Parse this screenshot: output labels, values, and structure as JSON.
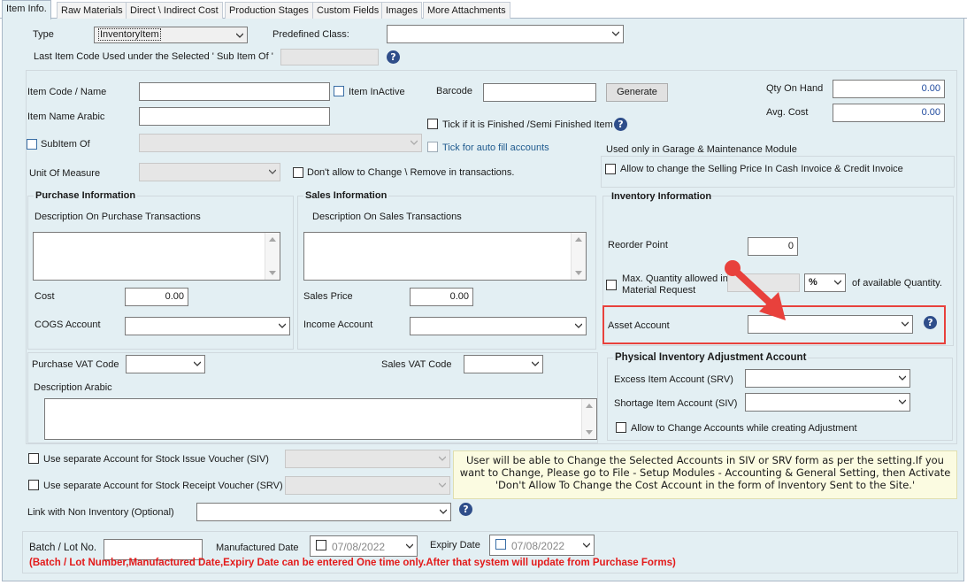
{
  "tabs": [
    {
      "label": "Item Info.",
      "active": true
    },
    {
      "label": "Raw Materials",
      "active": false
    },
    {
      "label": "Direct \\ Indirect Cost",
      "active": false
    },
    {
      "label": "Production Stages",
      "active": false
    },
    {
      "label": "Custom Fields",
      "active": false
    },
    {
      "label": "Images",
      "active": false
    },
    {
      "label": "More Attachments",
      "active": false
    }
  ],
  "top": {
    "type_label": "Type",
    "type_value": "InventoryItem",
    "predefined_class_label": "Predefined Class:",
    "predefined_class_value": "",
    "last_code_label": "Last Item Code Used under the Selected ' Sub Item Of '",
    "last_code_value": ""
  },
  "item": {
    "code_label": "Item Code / Name",
    "code_value": "",
    "inactive_label": "Item InActive",
    "barcode_label": "Barcode",
    "barcode_value": "",
    "generate_label": "Generate",
    "name_arabic_label": "Item Name Arabic",
    "name_arabic_value": "",
    "finished_label": "Tick if it is Finished /Semi Finished Item",
    "subitem_label": "SubItem Of",
    "autofill_label": "Tick for auto fill accounts",
    "uom_label": "Unit Of Measure",
    "dont_allow_label": "Don't allow to Change \\ Remove in transactions.",
    "qty_label": "Qty On Hand",
    "qty_value": "0.00",
    "avg_cost_label": "Avg. Cost",
    "avg_cost_value": "0.00"
  },
  "garage": {
    "title": "Used only in Garage & Maintenance Module",
    "allow_label": "Allow to change the Selling Price In Cash Invoice & Credit Invoice"
  },
  "purchase": {
    "title": "Purchase Information",
    "desc_label": "Description On  Purchase Transactions",
    "cost_label": "Cost",
    "cost_value": "0.00",
    "cogs_label": "COGS Account",
    "vat_label": "Purchase VAT Code"
  },
  "sales": {
    "title": "Sales Information",
    "desc_label": "Description On Sales Transactions",
    "price_label": "Sales Price",
    "price_value": "0.00",
    "income_label": "Income Account",
    "vat_label": "Sales VAT Code"
  },
  "inventory": {
    "title": "Inventory Information",
    "reorder_label": "Reorder Point",
    "reorder_value": "0",
    "maxqty_label_1": "Max. Quantity allowed in",
    "maxqty_label_2": "Material Request",
    "percent_value": "%",
    "available_label": "of available Quantity.",
    "asset_label": "Asset Account",
    "highlight_color": "#e8413c"
  },
  "physical": {
    "title": "Physical Inventory Adjustment Account",
    "excess_label": "Excess Item Account (SRV)",
    "shortage_label": "Shortage Item Account (SIV)",
    "allow_label": "Allow to Change Accounts while creating Adjustment"
  },
  "desc_arabic_label": "Description Arabic",
  "siv_label": "Use separate Account for Stock Issue Voucher (SIV)",
  "srv_label": "Use separate Account for Stock Receipt Voucher (SRV)",
  "note": "User will be able to Change the Selected Accounts in SIV or SRV form as per the setting.If you want to Change, Please go to File - Setup Modules - Accounting & General Setting, then Activate 'Don't Allow To Change the Cost Account in the form of Inventory Sent to the Site.'",
  "link_non_inv_label": "Link with Non Inventory (Optional)",
  "batch": {
    "batch_label": "Batch / Lot No.",
    "batch_value": "",
    "mfg_label": "Manufactured Date",
    "mfg_value": "07/08/2022",
    "expiry_label": "Expiry Date",
    "expiry_value": "07/08/2022",
    "warning": "(Batch / Lot Number,Manufactured Date,Expiry Date can be entered One time only.After that system will update from Purchase Forms)"
  },
  "help_glyph": "?",
  "icons": [
    "chevron-down-icon",
    "help-icon",
    "red-arrow-icon"
  ]
}
